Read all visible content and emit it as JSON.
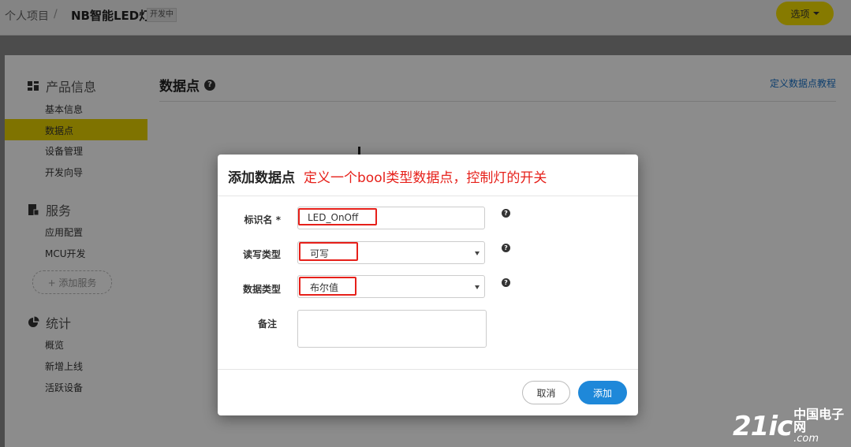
{
  "header": {
    "breadcrumb_root": "个人项目",
    "breadcrumb_sep": "/",
    "project_name": "NB智能LED灯",
    "status_badge": "开发中",
    "options_label": "选项"
  },
  "sidebar": {
    "sections": [
      {
        "title": "产品信息",
        "icon": "grid-icon",
        "items": [
          "基本信息",
          "数据点",
          "设备管理",
          "开发向导"
        ]
      },
      {
        "title": "服务",
        "icon": "document-icon",
        "items": [
          "应用配置",
          "MCU开发"
        ]
      },
      {
        "title": "统计",
        "icon": "pie-chart-icon",
        "items": [
          "概览",
          "新增上线",
          "活跃设备"
        ]
      }
    ],
    "add_service_label": "+ 添加服务",
    "active_item": "数据点"
  },
  "main": {
    "title": "数据点",
    "tutorial_link": "定义数据点教程"
  },
  "modal": {
    "title": "添加数据点",
    "annotation": "定义一个bool类型数据点，控制灯的开关",
    "fields": {
      "identifier_label": "标识名 *",
      "identifier_value": "LED_OnOff",
      "rw_label": "读写类型",
      "rw_value": "可写",
      "datatype_label": "数据类型",
      "datatype_value": "布尔值",
      "note_label": "备注",
      "note_value": ""
    },
    "help_glyph": "?",
    "cancel_label": "取消",
    "add_label": "添加"
  },
  "colors": {
    "accent_yellow": "#e8d200",
    "primary_blue": "#1e88d9",
    "highlight_red": "#e6201a"
  },
  "watermark": {
    "number": "21ic",
    "cn": "中国电子网",
    "domain": ".com"
  }
}
